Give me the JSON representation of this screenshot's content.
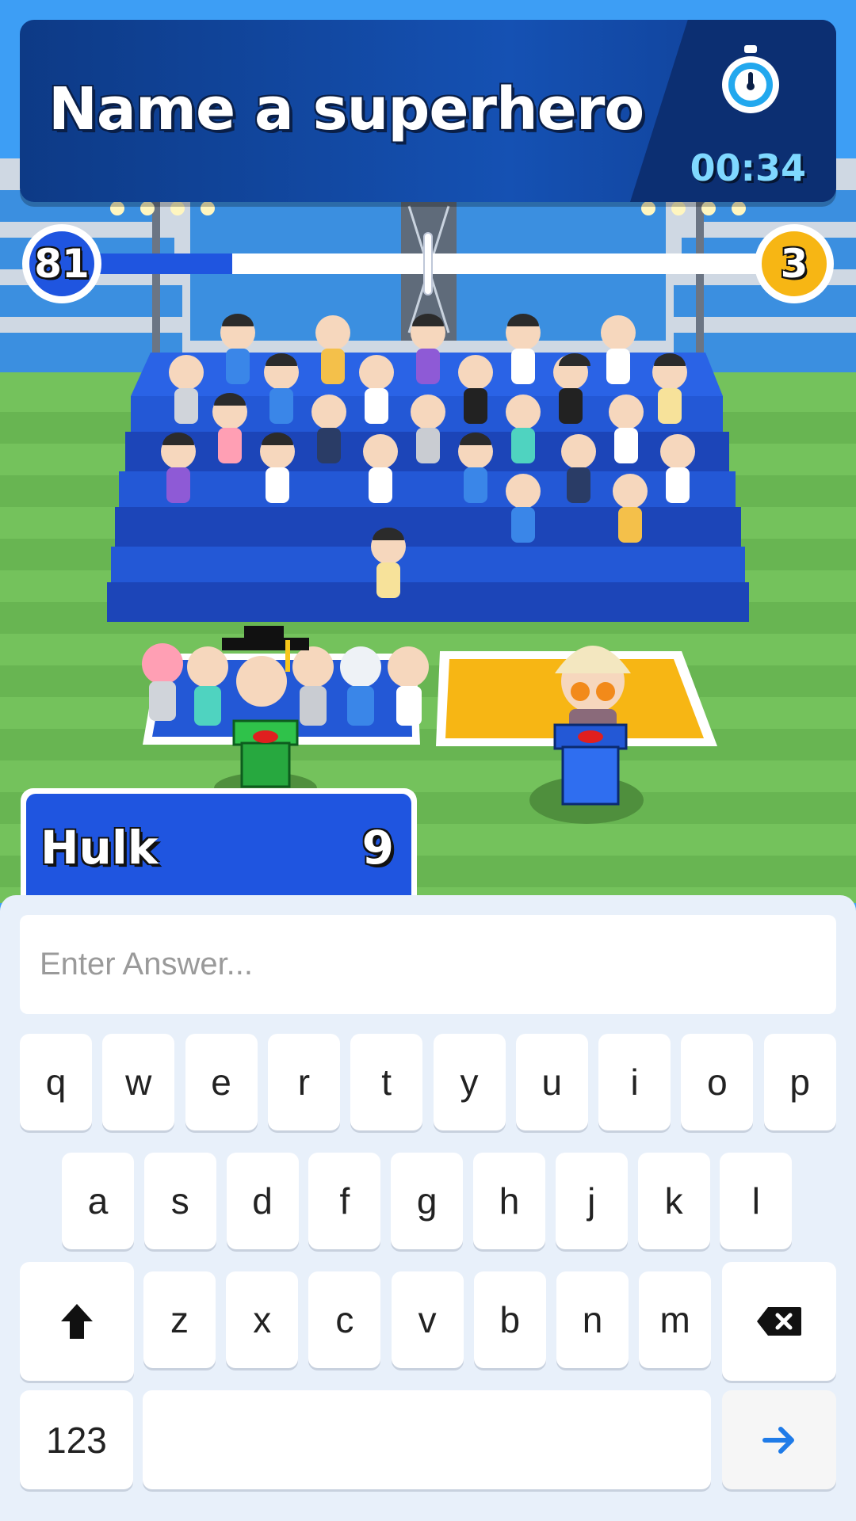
{
  "question": {
    "text": "Name a superhero",
    "timer": "00:34",
    "timer_icon": "stopwatch-icon"
  },
  "tug": {
    "left_score": "81",
    "right_score": "3",
    "left_color": "#1f55e0",
    "right_color": "#f7b614",
    "left_fill": 0.21,
    "right_fill": 0.01
  },
  "answer": {
    "text": "Hulk",
    "count": "9"
  },
  "input": {
    "placeholder": "Enter Answer...",
    "value": ""
  },
  "keyboard": {
    "row1": [
      "q",
      "w",
      "e",
      "r",
      "t",
      "y",
      "u",
      "i",
      "o",
      "p"
    ],
    "row2": [
      "a",
      "s",
      "d",
      "f",
      "g",
      "h",
      "j",
      "k",
      "l"
    ],
    "row3": [
      "z",
      "x",
      "c",
      "v",
      "b",
      "n",
      "m"
    ],
    "shift_icon": "shift-arrow-icon",
    "backspace_icon": "backspace-icon",
    "numbers_label": "123",
    "enter_icon": "arrow-right-icon"
  },
  "colors": {
    "sky": "#3d9ef5",
    "grass": "#74c25c",
    "bleacher": "#2358d6",
    "yellow_pad": "#f7b614"
  }
}
